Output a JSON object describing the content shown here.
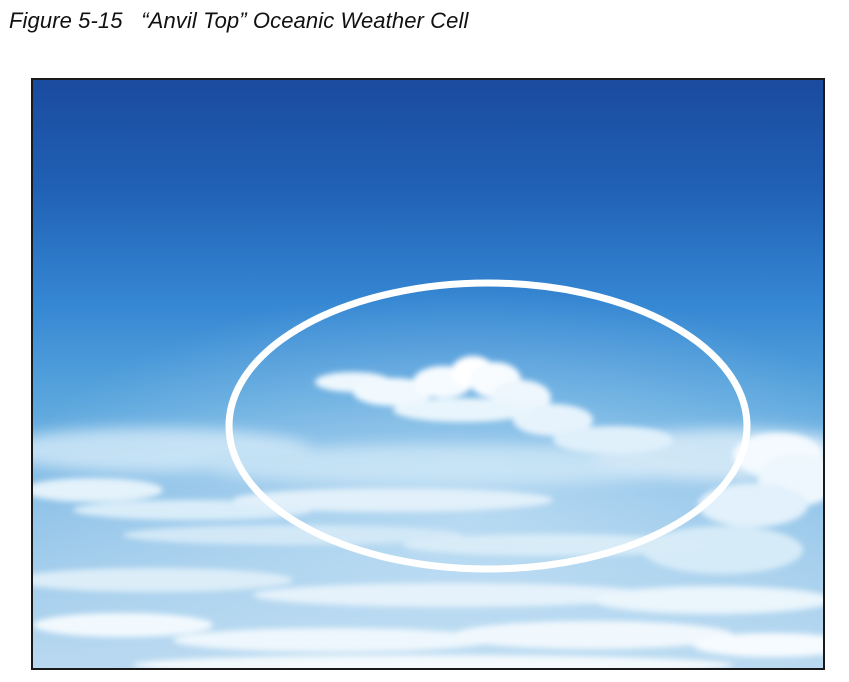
{
  "figure": {
    "caption": "Figure 5-15   “Anvil Top” Oceanic Weather Cell"
  },
  "photo": {
    "subject": "anvil-top oceanic weather cell",
    "highlight": "white ellipse circling the cloud formation",
    "colors": {
      "sky_top": "#1c4fa2",
      "sky_mid": "#2f7fd0",
      "sky_horizon": "#8cc4ea",
      "cloud_white": "#f4f9fd",
      "ellipse_stroke": "#ffffff"
    }
  }
}
